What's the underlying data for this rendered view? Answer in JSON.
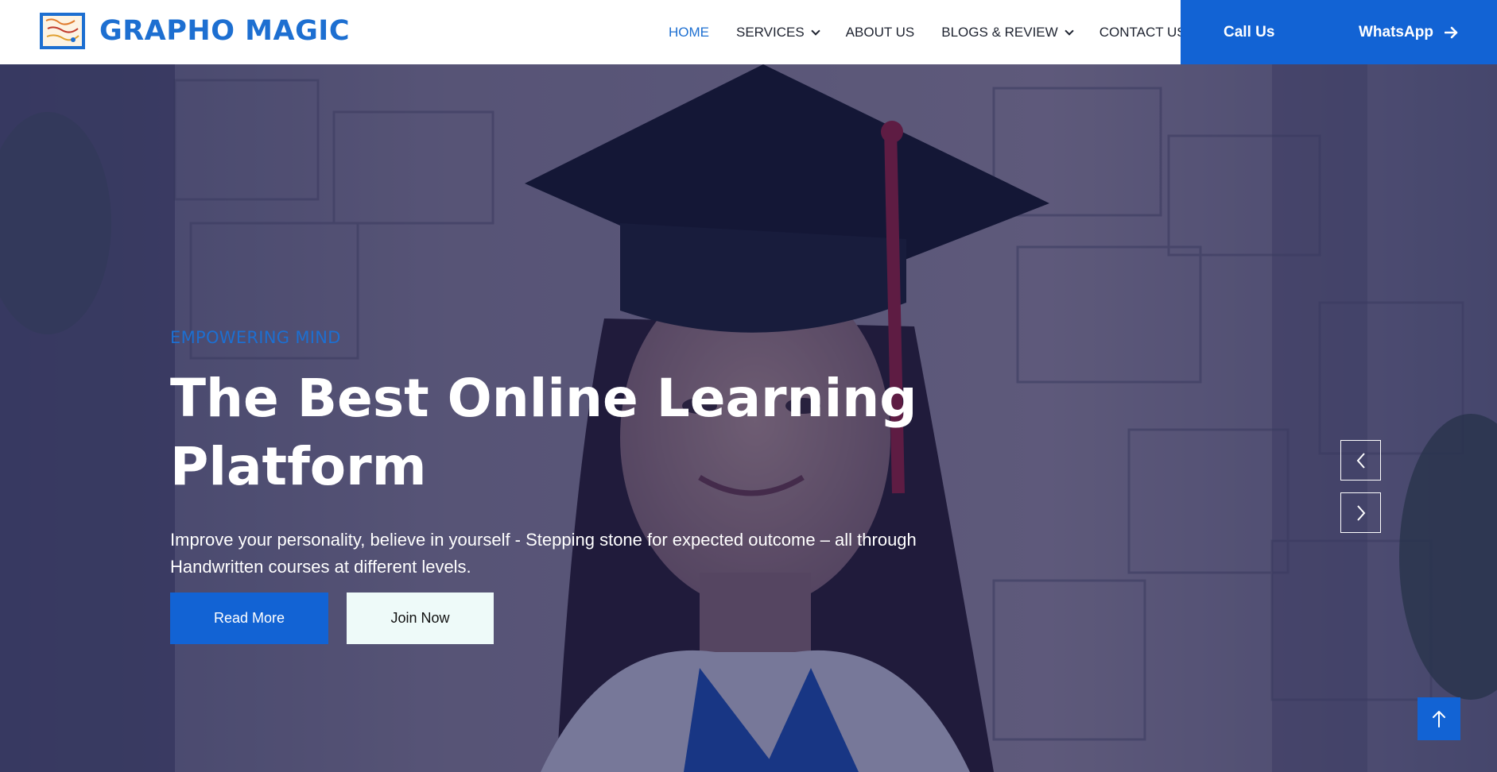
{
  "brand": {
    "name": "GRAPHO MAGIC",
    "logo_icon": "grapho-magic-logo"
  },
  "nav": {
    "items": [
      {
        "label": "HOME",
        "active": true,
        "dropdown": false
      },
      {
        "label": "SERVICES",
        "active": false,
        "dropdown": true
      },
      {
        "label": "ABOUT US",
        "active": false,
        "dropdown": false
      },
      {
        "label": "BLOGS & REVIEW",
        "active": false,
        "dropdown": true
      },
      {
        "label": "CONTACT US",
        "active": false,
        "dropdown": false
      }
    ]
  },
  "cta": {
    "call_label": "Call Us",
    "whatsapp_label": "WhatsApp",
    "whatsapp_icon": "arrow-right-icon"
  },
  "hero": {
    "eyebrow": "EMPOWERING MIND",
    "title": "The Best Online Learning Platform",
    "description": "Improve your personality, believe in yourself - Stepping stone for expected outcome – all through Handwritten courses at different levels.",
    "primary_button": "Read More",
    "secondary_button": "Join Now",
    "background_image": "graduate-student-photo"
  },
  "carousel": {
    "prev_icon": "chevron-left-icon",
    "next_icon": "chevron-right-icon"
  },
  "scroll_top": {
    "icon": "arrow-up-icon"
  },
  "colors": {
    "brand_blue": "#1263d4",
    "accent_blue": "#1d6fd1",
    "nav_text": "#1e2330",
    "hero_overlay": "#141950",
    "secondary_button_bg": "#eefaf9"
  }
}
